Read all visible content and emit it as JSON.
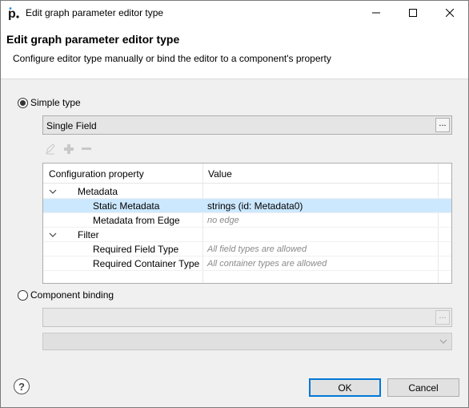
{
  "window": {
    "title": "Edit graph parameter editor type"
  },
  "header": {
    "title": "Edit graph parameter editor type",
    "description": "Configure editor type manually or bind the editor to a component's property"
  },
  "simple_type": {
    "label": "Simple type",
    "selected": true,
    "editor_value": "Single Field",
    "browse_label": "..."
  },
  "table": {
    "columns": [
      "Configuration property",
      "Value"
    ],
    "rows": [
      {
        "indent": 0,
        "expandable": true,
        "property": "Metadata",
        "value": "",
        "muted": false,
        "selected": false
      },
      {
        "indent": 1,
        "expandable": false,
        "property": "Static Metadata",
        "value": "strings (id: Metadata0)",
        "muted": false,
        "selected": true
      },
      {
        "indent": 1,
        "expandable": false,
        "property": "Metadata from Edge",
        "value": "no edge",
        "muted": true,
        "selected": false
      },
      {
        "indent": 0,
        "expandable": true,
        "property": "Filter",
        "value": "",
        "muted": false,
        "selected": false
      },
      {
        "indent": 1,
        "expandable": false,
        "property": "Required Field Type",
        "value": "All field types are allowed",
        "muted": true,
        "selected": false
      },
      {
        "indent": 1,
        "expandable": false,
        "property": "Required Container Type",
        "value": "All container types are allowed",
        "muted": true,
        "selected": false
      }
    ]
  },
  "component_binding": {
    "label": "Component binding",
    "selected": false,
    "browse_label": "..."
  },
  "buttons": {
    "ok": "OK",
    "cancel": "Cancel",
    "help": "?"
  },
  "colors": {
    "selection": "#cce8ff",
    "accent": "#0078d7",
    "muted_text": "#8a8a8a"
  }
}
